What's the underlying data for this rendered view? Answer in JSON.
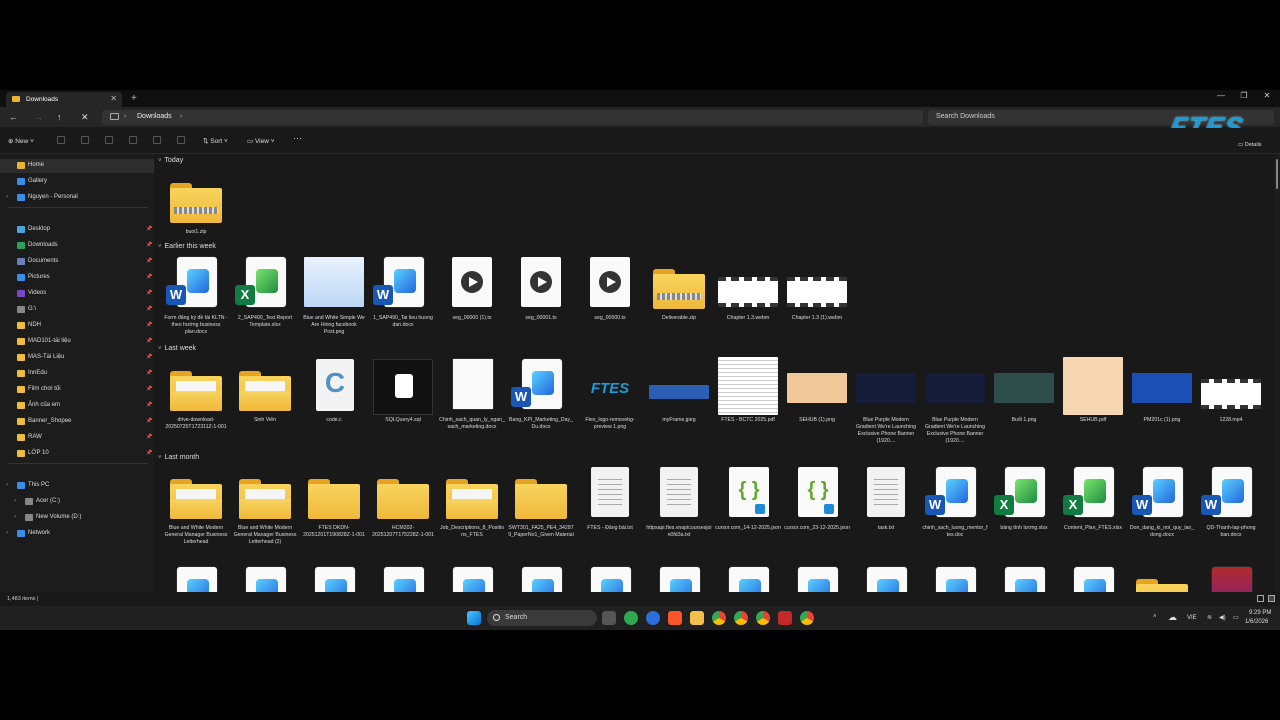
{
  "window": {
    "tab_title": "Downloads"
  },
  "address": {
    "crumb": "Downloads",
    "search_placeholder": "Search Downloads"
  },
  "toolbar": {
    "new": "New",
    "sort": "Sort",
    "view": "View",
    "details": "Details"
  },
  "logo": "FTES",
  "sidebar": [
    {
      "label": "Home",
      "icon": "home-icon",
      "selected": true
    },
    {
      "label": "Gallery",
      "icon": "gallery-icon"
    },
    {
      "label": "Nguyen - Personal",
      "icon": "cloud-icon"
    },
    {
      "label": "Desktop",
      "icon": "desktop-icon"
    },
    {
      "label": "Downloads",
      "icon": "download-icon"
    },
    {
      "label": "Documents",
      "icon": "documents-icon"
    },
    {
      "label": "Pictures",
      "icon": "pictures-icon"
    },
    {
      "label": "Videos",
      "icon": "videos-icon"
    },
    {
      "label": "G:\\",
      "icon": "drive-icon"
    },
    {
      "label": "NDH",
      "icon": "folder-icon"
    },
    {
      "label": "MAD101-tài liệu",
      "icon": "folder-icon"
    },
    {
      "label": "MAS-Tài Liệu",
      "icon": "folder-icon"
    },
    {
      "label": "InnEdu",
      "icon": "folder-icon"
    },
    {
      "label": "Film chơi tối",
      "icon": "folder-icon"
    },
    {
      "label": "Ảnh của em",
      "icon": "folder-icon"
    },
    {
      "label": "Banner_Shopee",
      "icon": "folder-icon"
    },
    {
      "label": "RAW",
      "icon": "folder-icon"
    },
    {
      "label": "LỚP 10",
      "icon": "folder-icon"
    },
    {
      "label": "This PC",
      "icon": "pc-icon"
    },
    {
      "label": "Acer (C:)",
      "icon": "drive-icon"
    },
    {
      "label": "New Volume (D:)",
      "icon": "drive-icon"
    },
    {
      "label": "Network",
      "icon": "network-icon"
    }
  ],
  "groups": [
    {
      "title": "Today",
      "files": [
        {
          "name": "buoi1.zip",
          "kind": "zip"
        }
      ]
    },
    {
      "title": "Earlier this week",
      "files": [
        {
          "name": "Form đăng ký đề tài KLTN - theo hướng business plan.docx",
          "kind": "word"
        },
        {
          "name": "2_SAP490_Test Report Template.xlsx",
          "kind": "excel"
        },
        {
          "name": "Blue and White Simple We Are Hiring facebook Post.png",
          "kind": "img-hiring"
        },
        {
          "name": "1_SAP490_Tai lieu huong dan.docx",
          "kind": "word"
        },
        {
          "name": "seg_00000 (1).ts",
          "kind": "media"
        },
        {
          "name": "seg_00001.ts",
          "kind": "media"
        },
        {
          "name": "seg_00000.ts",
          "kind": "media"
        },
        {
          "name": "Deliverable.zip",
          "kind": "zip"
        },
        {
          "name": "Chapter 1.3.webm",
          "kind": "film"
        },
        {
          "name": "Chapter 1.3 (1).webm",
          "kind": "film"
        }
      ]
    },
    {
      "title": "Last week",
      "files": [
        {
          "name": "drive-download-20250725T172311Z-1-001",
          "kind": "folder-paper"
        },
        {
          "name": "Sinh Viên",
          "kind": "folder-paper"
        },
        {
          "name": "code.c",
          "kind": "cfile"
        },
        {
          "name": "SQLQuery4.sql",
          "kind": "sql"
        },
        {
          "name": "Chinh_sach_quan_ly_ngan_sach_marketing.docx",
          "kind": "blank"
        },
        {
          "name": "Bang_KPI_Marketing_Day_Du.docx",
          "kind": "word"
        },
        {
          "name": "Ftes_logo-removebg-preview 1.png",
          "kind": "img-ftes"
        },
        {
          "name": "myFrame.jpeg",
          "kind": "img-frame"
        },
        {
          "name": "FTES - BCTC 2025.pdf",
          "kind": "img-pdf"
        },
        {
          "name": "SEHUB (1).png",
          "kind": "img-sehub"
        },
        {
          "name": "Blue Purple Modern Gradient We're Launching Exclusive Phone Banner (1920....",
          "kind": "img-dark"
        },
        {
          "name": "Blue Purple Modern Gradient We're Launching Exclusive Phone Banner (1920....",
          "kind": "img-dark"
        },
        {
          "name": "Buổi 1.png",
          "kind": "img-teal"
        },
        {
          "name": "SEHUB.pdf",
          "kind": "img-sehub2"
        },
        {
          "name": "PM201c (1).png",
          "kind": "img-blue"
        },
        {
          "name": "1228.mp4",
          "kind": "film"
        }
      ]
    },
    {
      "title": "Last month",
      "files": [
        {
          "name": "Blue and White Modern General Manager Business Letterhead",
          "kind": "folder-paper"
        },
        {
          "name": "Blue and White Modern General Manager Business Letterhead (2)",
          "kind": "folder-paper"
        },
        {
          "name": "FTES DKDN-20251201T190828Z-1-001",
          "kind": "folder"
        },
        {
          "name": "HCM202-20251207T175228Z-1-001",
          "kind": "folder"
        },
        {
          "name": "Job_Descriptions_8_Positions_FTES",
          "kind": "folder-paper"
        },
        {
          "name": "SWT301_FA25_PE4_342879_PaperNo1_Given Material",
          "kind": "folder"
        },
        {
          "name": "FTES - Đăng bài.txt",
          "kind": "txt"
        },
        {
          "name": "httpsapi.ftes.vnapicoursesjoin0fd3a.txt",
          "kind": "txt"
        },
        {
          "name": "cursor.com_14-12-2025.json",
          "kind": "json"
        },
        {
          "name": "cursor.com_23-12-2025.json",
          "kind": "json"
        },
        {
          "name": "task.txt",
          "kind": "txt"
        },
        {
          "name": "chinh_sach_luong_mentor_ftes.doc",
          "kind": "word"
        },
        {
          "name": "bảng tính lương.xlsx",
          "kind": "excel"
        },
        {
          "name": "Content_Plan_FTES.xlsx",
          "kind": "excel"
        },
        {
          "name": "Don_dang_ki_noi_quy_lao_dong.docx",
          "kind": "word"
        },
        {
          "name": "QD-Thanh-lap-phong ban.docx",
          "kind": "word"
        }
      ]
    }
  ],
  "status": {
    "items": "1,483 items  |"
  },
  "taskbar": {
    "search": "Search",
    "lang": "VIE",
    "time": "9:29 PM",
    "date": "1/6/2026"
  },
  "colors": {
    "folder": "#f5c84a",
    "word": "#1857b6",
    "excel": "#107c41",
    "accent": "#1a9bd9"
  }
}
